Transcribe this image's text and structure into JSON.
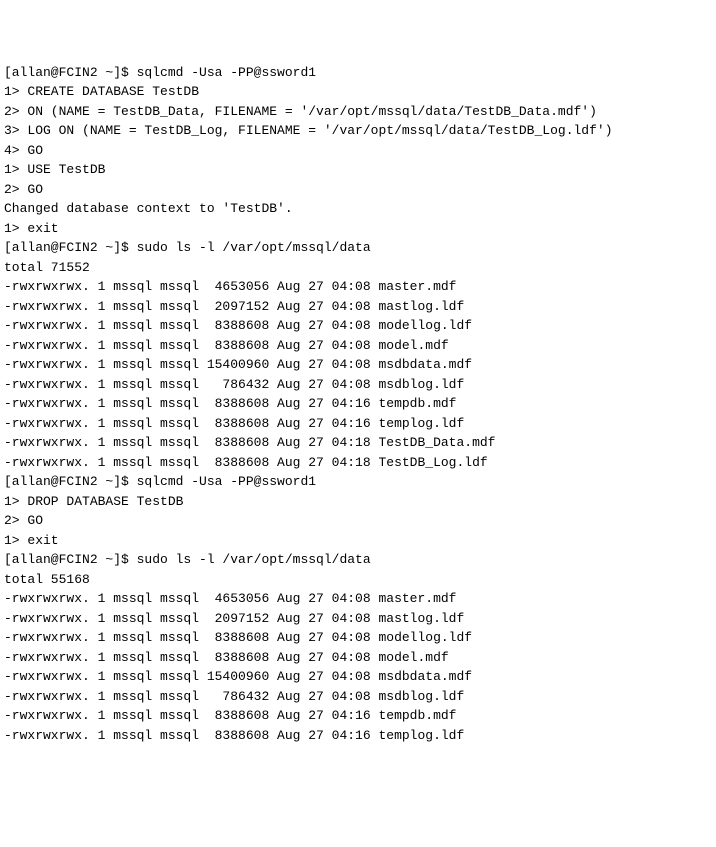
{
  "lines": [
    "[allan@FCIN2 ~]$ sqlcmd -Usa -PP@ssword1",
    "1> CREATE DATABASE TestDB",
    "2> ON (NAME = TestDB_Data, FILENAME = '/var/opt/mssql/data/TestDB_Data.mdf')",
    "3> LOG ON (NAME = TestDB_Log, FILENAME = '/var/opt/mssql/data/TestDB_Log.ldf')",
    "4> GO",
    "1> USE TestDB",
    "2> GO",
    "Changed database context to 'TestDB'.",
    "1> exit",
    "[allan@FCIN2 ~]$ sudo ls -l /var/opt/mssql/data",
    "total 71552",
    "-rwxrwxrwx. 1 mssql mssql  4653056 Aug 27 04:08 master.mdf",
    "-rwxrwxrwx. 1 mssql mssql  2097152 Aug 27 04:08 mastlog.ldf",
    "-rwxrwxrwx. 1 mssql mssql  8388608 Aug 27 04:08 modellog.ldf",
    "-rwxrwxrwx. 1 mssql mssql  8388608 Aug 27 04:08 model.mdf",
    "-rwxrwxrwx. 1 mssql mssql 15400960 Aug 27 04:08 msdbdata.mdf",
    "-rwxrwxrwx. 1 mssql mssql   786432 Aug 27 04:08 msdblog.ldf",
    "-rwxrwxrwx. 1 mssql mssql  8388608 Aug 27 04:16 tempdb.mdf",
    "-rwxrwxrwx. 1 mssql mssql  8388608 Aug 27 04:16 templog.ldf",
    "-rwxrwxrwx. 1 mssql mssql  8388608 Aug 27 04:18 TestDB_Data.mdf",
    "-rwxrwxrwx. 1 mssql mssql  8388608 Aug 27 04:18 TestDB_Log.ldf",
    "[allan@FCIN2 ~]$ sqlcmd -Usa -PP@ssword1",
    "1> DROP DATABASE TestDB",
    "2> GO",
    "1> exit",
    "[allan@FCIN2 ~]$ sudo ls -l /var/opt/mssql/data",
    "total 55168",
    "-rwxrwxrwx. 1 mssql mssql  4653056 Aug 27 04:08 master.mdf",
    "-rwxrwxrwx. 1 mssql mssql  2097152 Aug 27 04:08 mastlog.ldf",
    "-rwxrwxrwx. 1 mssql mssql  8388608 Aug 27 04:08 modellog.ldf",
    "-rwxrwxrwx. 1 mssql mssql  8388608 Aug 27 04:08 model.mdf",
    "-rwxrwxrwx. 1 mssql mssql 15400960 Aug 27 04:08 msdbdata.mdf",
    "-rwxrwxrwx. 1 mssql mssql   786432 Aug 27 04:08 msdblog.ldf",
    "-rwxrwxrwx. 1 mssql mssql  8388608 Aug 27 04:16 tempdb.mdf",
    "-rwxrwxrwx. 1 mssql mssql  8388608 Aug 27 04:16 templog.ldf"
  ]
}
